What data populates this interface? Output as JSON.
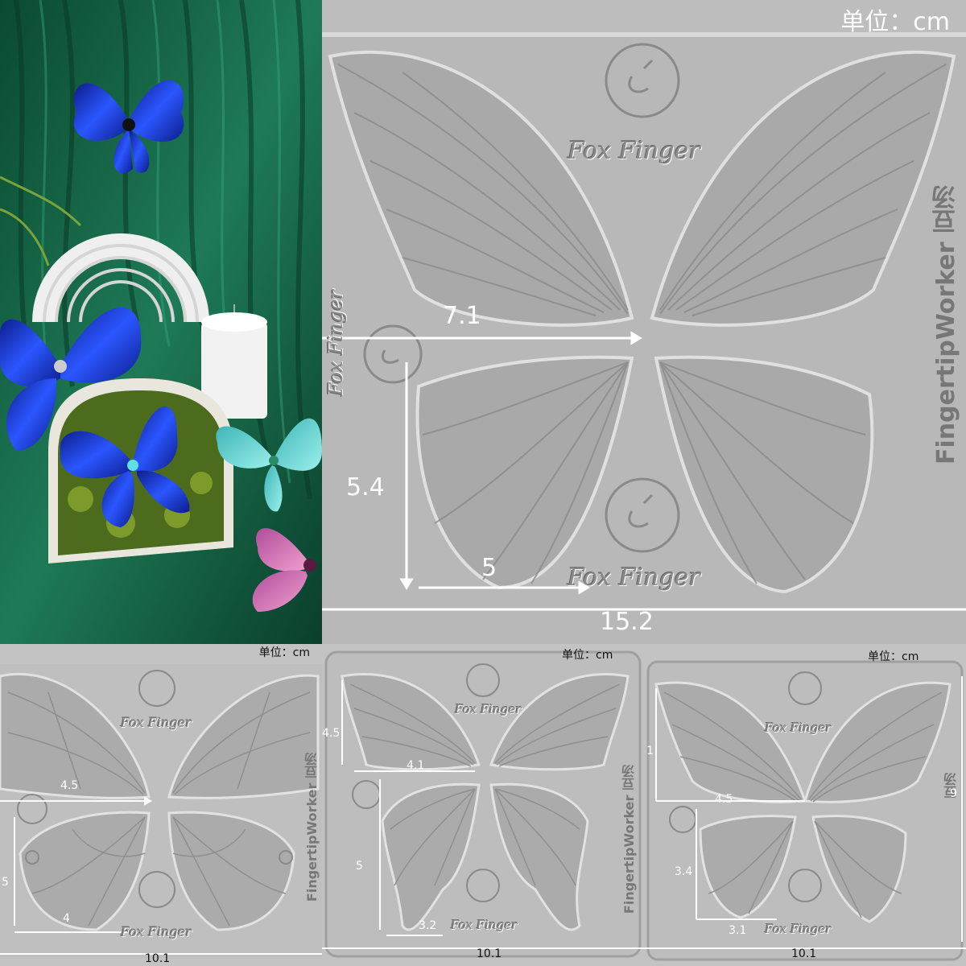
{
  "colors": {
    "mold": "#bdbdbd",
    "mold_light": "#d0d0d0",
    "mold_dark": "#8c8c8c",
    "dim_line": "#ffffff",
    "velvet": "#0f5a3e",
    "butterfly_blue": "#1d3fd6",
    "butterfly_teal": "#67d3d3",
    "flower_pink": "#e27bb8"
  },
  "main": {
    "unit_label": "单位：cm",
    "brand_text": "Fox Finger",
    "side_brand": "FingertipWorker 豆汤",
    "dims": {
      "upper_wing_width": "7.1",
      "lower_wing_height": "5.4",
      "lower_wing_width": "5",
      "total_width": "15.2"
    }
  },
  "mold_1": {
    "unit_label": "单位：cm",
    "brand_text": "Fox Finger",
    "side_brand": "FingertipWorker 豆汤",
    "dims": {
      "upper_wing_width": "4.5",
      "lower_wing_height": "5",
      "lower_wing_width": "4",
      "total_width": "10.1"
    }
  },
  "mold_2": {
    "unit_label": "单位：cm",
    "brand_text": "Fox Finger",
    "side_brand": "FingertipWorker 豆汤",
    "dims": {
      "upper_wing_height": "4.5",
      "upper_wing_width": "4.1",
      "lower_wing_height": "5",
      "lower_wing_width": "3.2",
      "total_width": "10.1"
    }
  },
  "mold_3": {
    "unit_label": "单位：cm",
    "brand_text": "Fox Finger",
    "side_brand": "豆汤",
    "dims": {
      "upper_wing_height": "1",
      "upper_wing_width": "4.5",
      "lower_wing_height": "3.4",
      "lower_wing_width": "3.1",
      "total_width": "10.1",
      "total_height": "9"
    }
  }
}
